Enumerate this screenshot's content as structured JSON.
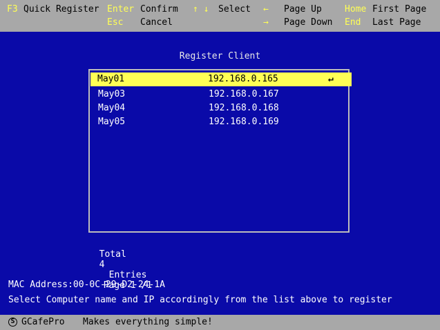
{
  "hotkeys": {
    "f3_key": "F3",
    "f3_label": "Quick Register",
    "enter_key": "Enter",
    "enter_label": "Confirm",
    "esc_key": "Esc",
    "esc_label": "Cancel",
    "updown_key": "↑ ↓",
    "updown_label": "Select",
    "left_key": "←",
    "left_label": "Page Up",
    "right_key": "→",
    "right_label": "Page Down",
    "home_key": "Home",
    "home_label": "First Page",
    "end_key": "End",
    "end_label": "Last Page"
  },
  "dialog": {
    "title": "Register Client",
    "rows": [
      {
        "name": "May01",
        "ip": "192.168.0.165",
        "selected": true
      },
      {
        "name": "May03",
        "ip": "192.168.0.167",
        "selected": false
      },
      {
        "name": "May04",
        "ip": "192.168.0.168",
        "selected": false
      },
      {
        "name": "May05",
        "ip": "192.168.0.169",
        "selected": false
      }
    ],
    "enter_symbol": "↵",
    "total_label": "Total",
    "total_count": "4",
    "entries_label": "Entries",
    "page_label": "Page 1 /1"
  },
  "info": {
    "mac_line": "MAC Address:00-0C-29-D2-24-1A",
    "instruction": "Select Computer name and IP accordingly from the list above to register"
  },
  "status": {
    "logo_glyph": "S",
    "app_name": "GCafePro",
    "slogan": "Makes everything simple!"
  },
  "colors": {
    "background": "#0a0aa8",
    "bar": "#a8a8a8",
    "highlight": "#ffff55"
  }
}
